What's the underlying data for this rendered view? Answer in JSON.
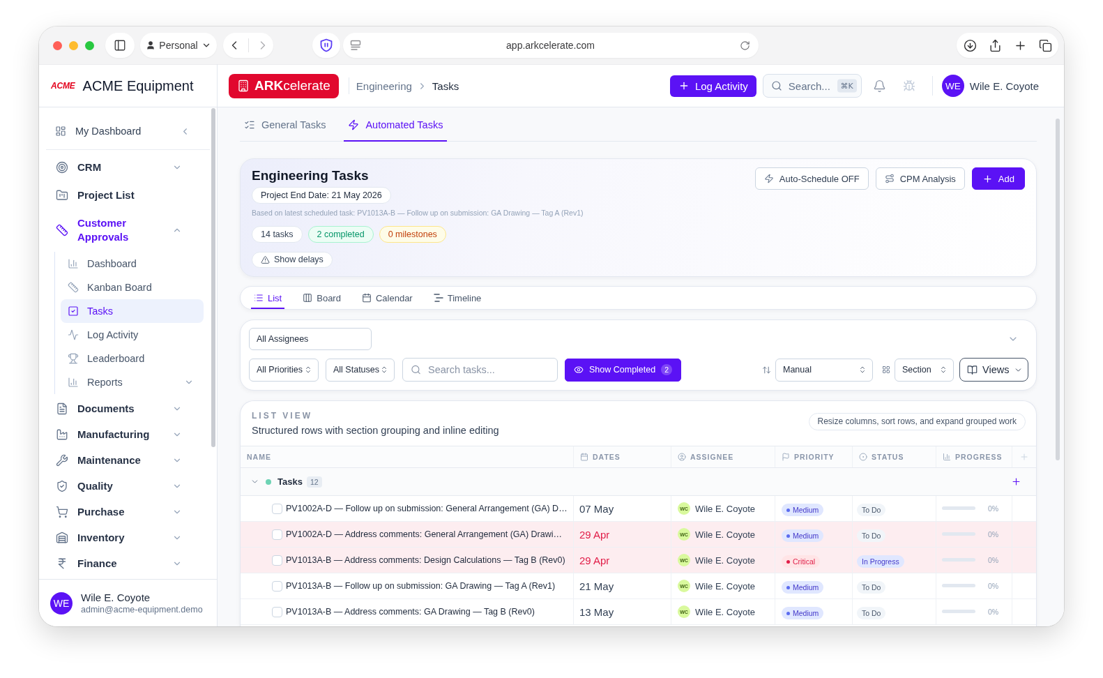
{
  "browser": {
    "profile": "Personal",
    "url": "app.arkcelerate.com"
  },
  "sidebar": {
    "logo": "ACME",
    "company": "ACME Equipment",
    "dashboard": "My Dashboard",
    "items": [
      {
        "label": "CRM",
        "kind": "group",
        "selected": false,
        "expanded": false
      },
      {
        "label": "Project List",
        "kind": "link",
        "selected": false
      },
      {
        "label": "Customer Approvals",
        "kind": "group",
        "selected": true,
        "expanded": true,
        "children": [
          {
            "label": "Dashboard",
            "kind": "link",
            "selected": false
          },
          {
            "label": "Kanban Board",
            "kind": "link",
            "selected": false
          },
          {
            "label": "Tasks",
            "kind": "link",
            "selected": true
          },
          {
            "label": "Log Activity",
            "kind": "link",
            "selected": false
          },
          {
            "label": "Leaderboard",
            "kind": "link",
            "selected": false
          },
          {
            "label": "Reports",
            "kind": "group",
            "selected": false,
            "expanded": false
          }
        ]
      },
      {
        "label": "Documents",
        "kind": "group",
        "selected": false,
        "expanded": false
      },
      {
        "label": "Manufacturing",
        "kind": "group",
        "selected": false,
        "expanded": false
      },
      {
        "label": "Maintenance",
        "kind": "group",
        "selected": false,
        "expanded": false
      },
      {
        "label": "Quality",
        "kind": "group",
        "selected": false,
        "expanded": false
      },
      {
        "label": "Purchase",
        "kind": "group",
        "selected": false,
        "expanded": false
      },
      {
        "label": "Inventory",
        "kind": "group",
        "selected": false,
        "expanded": false
      },
      {
        "label": "Finance",
        "kind": "group",
        "selected": false,
        "expanded": false
      }
    ],
    "user": {
      "initials": "WE",
      "name": "Wile E. Coyote",
      "email": "admin@acme-equipment.demo"
    }
  },
  "header": {
    "brand": "**ARK**celerate",
    "breadcrumb": [
      {
        "label": "Engineering",
        "current": false
      },
      {
        "label": "Tasks",
        "current": true
      }
    ],
    "log_button": "Log Activity",
    "search": {
      "placeholder": "Search...",
      "shortcut": "⌘K"
    },
    "user": {
      "initials": "WE",
      "name": "Wile E. Coyote"
    }
  },
  "page_tabs": [
    {
      "label": "General Tasks",
      "selected": false
    },
    {
      "label": "Automated Tasks",
      "selected": true
    }
  ],
  "summary": {
    "title": "Engineering Tasks",
    "end_date": "Project End Date: 21 May 2026",
    "note": "Based on latest scheduled task: PV1013A-B — Follow up on submission: GA Drawing — Tag A (Rev1)",
    "stats": [
      {
        "label": "14 tasks",
        "kind": "neutral"
      },
      {
        "label": "2 completed",
        "kind": "success"
      },
      {
        "label": "0 milestones",
        "kind": "warning"
      }
    ],
    "delays_button": "Show delays",
    "actions": [
      {
        "label": "Auto-Schedule OFF",
        "kind": "outline"
      },
      {
        "label": "CPM Analysis",
        "kind": "outline"
      },
      {
        "label": "Add",
        "kind": "primary"
      }
    ]
  },
  "view_tabs": [
    {
      "label": "List",
      "selected": true
    },
    {
      "label": "Board",
      "selected": false
    },
    {
      "label": "Calendar",
      "selected": false
    },
    {
      "label": "Timeline",
      "selected": false
    }
  ],
  "filters": {
    "assignee": "All Assignees",
    "priority": "All Priorities",
    "status": "All Statuses",
    "search": {
      "placeholder": "Search tasks..."
    },
    "show_completed": {
      "label": "Show Completed",
      "count": "2",
      "on": true
    },
    "sort": "Manual",
    "group_by": "Section",
    "views": "Views"
  },
  "list": {
    "eyebrow": "LIST VIEW",
    "subtitle": "Structured rows with section grouping and inline editing",
    "hint": "Resize columns, sort rows, and expand grouped work",
    "columns": [
      "NAME",
      "DATES",
      "ASSIGNEE",
      "PRIORITY",
      "STATUS",
      "PROGRESS"
    ],
    "groups": [
      {
        "name": "Tasks",
        "count": "12",
        "color": "#6dd3b4",
        "expanded": true,
        "rows": [
          {
            "name": "PV1002A-D — Follow up on submission: General Arrangement (GA) D…",
            "checked": false,
            "date": "07 May",
            "overdue": false,
            "assignee_initials": "WC",
            "assignee": "Wile E. Coyote",
            "priority": {
              "label": "Medium",
              "kind": "medium"
            },
            "status": {
              "label": "To Do",
              "kind": "todo"
            },
            "level": 0,
            "progress": "0%"
          },
          {
            "name": "PV1002A-D — Address comments: General Arrangement (GA) Drawi…",
            "checked": false,
            "date": "29 Apr",
            "overdue": true,
            "assignee_initials": "WC",
            "assignee": "Wile E. Coyote",
            "priority": {
              "label": "Medium",
              "kind": "medium"
            },
            "status": {
              "label": "To Do",
              "kind": "todo"
            },
            "level": 0,
            "progress": "0%"
          },
          {
            "name": "PV1013A-B — Address comments: Design Calculations — Tag B (Rev0)",
            "checked": false,
            "date": "29 Apr",
            "overdue": true,
            "assignee_initials": "WC",
            "assignee": "Wile E. Coyote",
            "priority": {
              "label": "Critical",
              "kind": "critical"
            },
            "status": {
              "label": "In Progress",
              "kind": "in_progress"
            },
            "level": 0,
            "progress": "0%"
          },
          {
            "name": "PV1013A-B — Follow up on submission: GA Drawing — Tag A (Rev1)",
            "checked": false,
            "date": "21 May",
            "overdue": false,
            "assignee_initials": "WC",
            "assignee": "Wile E. Coyote",
            "priority": {
              "label": "Medium",
              "kind": "medium"
            },
            "status": {
              "label": "To Do",
              "kind": "todo"
            },
            "level": 0,
            "progress": "0%"
          },
          {
            "name": "PV1013A-B — Address comments: GA Drawing — Tag B (Rev0)",
            "checked": false,
            "date": "13 May",
            "overdue": false,
            "assignee_initials": "WC",
            "assignee": "Wile E. Coyote",
            "priority": {
              "label": "Medium",
              "kind": "medium"
            },
            "status": {
              "label": "To Do",
              "kind": "todo"
            },
            "level": 0,
            "progress": "0%"
          }
        ]
      }
    ]
  }
}
